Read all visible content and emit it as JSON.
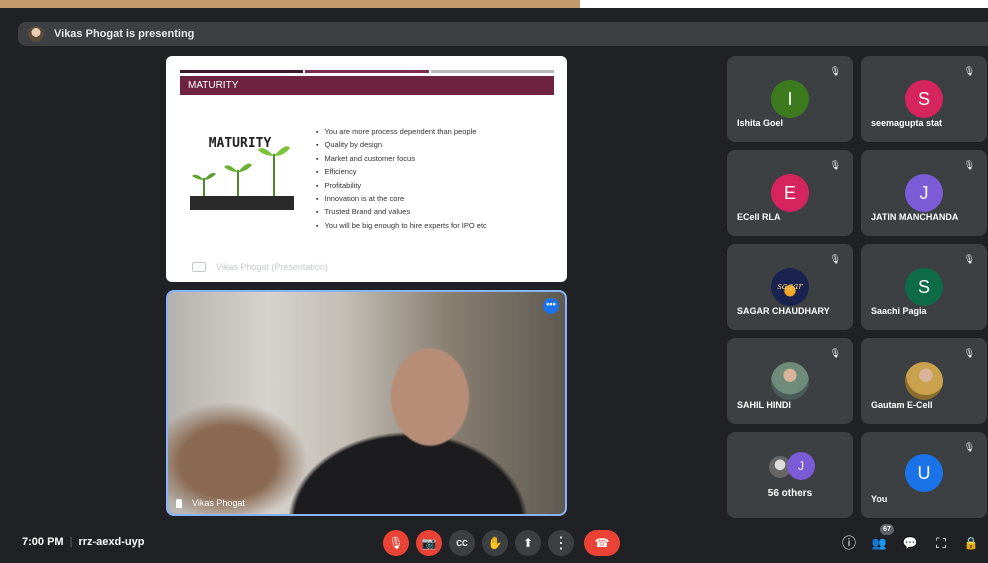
{
  "presenter_banner": {
    "text": "Vikas Phogat is presenting"
  },
  "slide": {
    "title": "MATURITY",
    "art_title": "MATURITY",
    "bullets": [
      "You are more process dependent than people",
      "Quality by design",
      "Market and customer focus",
      "Efficiency",
      "Profitability",
      "Innovation is at the core",
      "Trusted Brand and values",
      "You will be big enough to hire experts for IPO etc"
    ],
    "footer": "Vikas Phogat (Presentation)",
    "rule_colors": [
      "#3b1a2a",
      "#7a2c4a",
      "#b9b9b9"
    ]
  },
  "main_video": {
    "name": "Vikas Phogat",
    "menu": "•••"
  },
  "participants": [
    {
      "name": "Ishita Goel",
      "initial": "I",
      "color": "#3d7a1e",
      "muted": true
    },
    {
      "name": "seemagupta stat",
      "initial": "S",
      "color": "#d6245e",
      "muted": true
    },
    {
      "name": "ECell RLA",
      "initial": "E",
      "color": "#d6245e",
      "muted": true
    },
    {
      "name": "JATIN MANCHANDA",
      "initial": "J",
      "color": "#7b5bd6",
      "muted": true
    },
    {
      "name": "SAGAR CHAUDHARY",
      "initial": "sagar",
      "color": "#1a2350",
      "muted": true
    },
    {
      "name": "Saachi Pagia",
      "initial": "S",
      "color": "#0e6b48",
      "muted": true
    },
    {
      "name": "SAHIL HINDI",
      "initial": "",
      "color": "#6f8b7a",
      "muted": true
    },
    {
      "name": "Gautam E-Cell",
      "initial": "",
      "color": "#caa24e",
      "muted": true
    },
    {
      "name": "You",
      "initial": "U",
      "color": "#1a73e8",
      "muted": true
    }
  ],
  "others": {
    "label": "56 others",
    "initial": "J"
  },
  "bottom": {
    "time": "7:00 PM",
    "meeting_code": "rrz-aexd-uyp",
    "people_count": "67"
  },
  "icons": {
    "mute": "🎙",
    "mic_off": "🎙",
    "cam_off": "📷",
    "captions": "CC",
    "hand": "✋",
    "present": "⬆",
    "more": "⋮",
    "end": "☎",
    "info": "ⓘ",
    "people": "👥",
    "chat": "💬",
    "activities": "⛶",
    "host": "🔒"
  }
}
